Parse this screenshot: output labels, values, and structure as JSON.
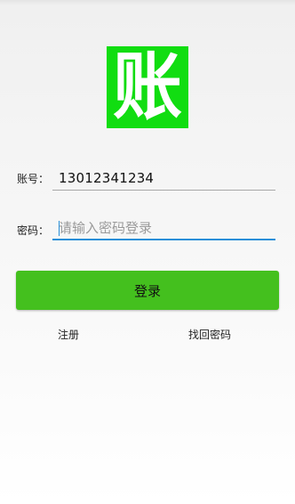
{
  "logo": {
    "glyph": "账",
    "background_color": "#11dd11",
    "glyph_color": "#ffffff"
  },
  "form": {
    "account_label": "账号：",
    "account_value": "13012341234",
    "password_label": "密码：",
    "password_placeholder": "请输入密码登录",
    "password_value": ""
  },
  "actions": {
    "login_label": "登录",
    "register_label": "注册",
    "forgot_password_label": "找回密码"
  },
  "colors": {
    "login_button": "#44c01e",
    "focus_underline": "#2a8fd8"
  }
}
